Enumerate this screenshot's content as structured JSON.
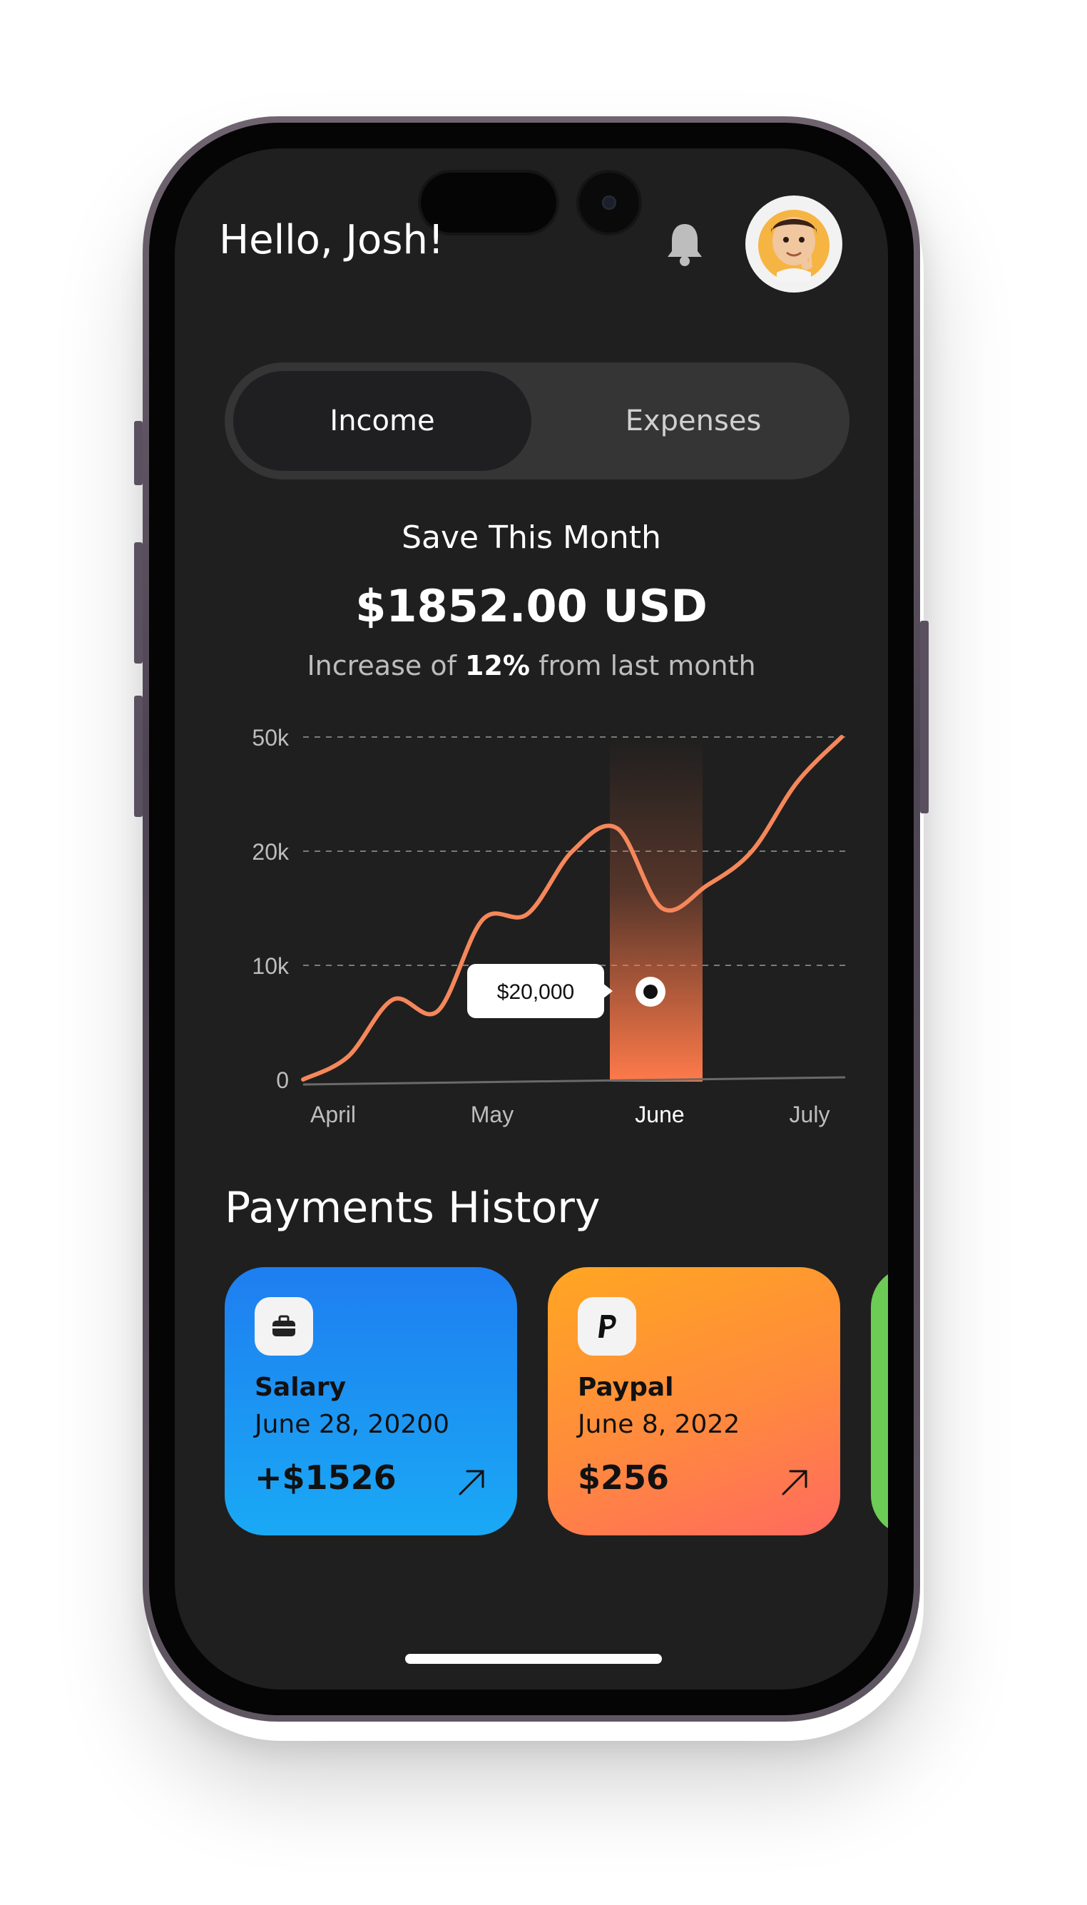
{
  "header": {
    "greeting": "Hello, Josh!",
    "bell_icon": "bell-icon",
    "avatar_icon": "memoji-avatar"
  },
  "toggle": {
    "income_label": "Income",
    "expenses_label": "Expenses",
    "selected": "Income"
  },
  "summary": {
    "title": "Save This Month",
    "amount": "$1852.00 USD",
    "sub_prefix": "Increase of ",
    "sub_percent": "12%",
    "sub_suffix": " from last month"
  },
  "chart_data": {
    "type": "line",
    "y_ticks": [
      "0",
      "10k",
      "20k",
      "50k"
    ],
    "x_labels": [
      "April",
      "May",
      "June",
      "July"
    ],
    "highlight_category": "June",
    "tooltip": "$20,000",
    "series": [
      {
        "values": [
          0,
          2,
          7,
          6,
          14,
          14.5,
          20,
          21,
          15,
          17,
          20,
          23,
          25
        ]
      }
    ],
    "line_color": "#f5875a",
    "grid": "dashed"
  },
  "payments": {
    "title": "Payments History",
    "cards": [
      {
        "icon": "briefcase-icon",
        "title": "Salary",
        "date": "June 28, 20200",
        "amount": "+$1526",
        "arrow_icon": "arrow-up-right-icon",
        "color": "#1e8ef2"
      },
      {
        "icon": "paypal-icon",
        "title": "Paypal",
        "date": "June 8, 2022",
        "amount": "$256",
        "arrow_icon": "arrow-up-right-icon",
        "color": "#ff8a3d"
      }
    ]
  }
}
